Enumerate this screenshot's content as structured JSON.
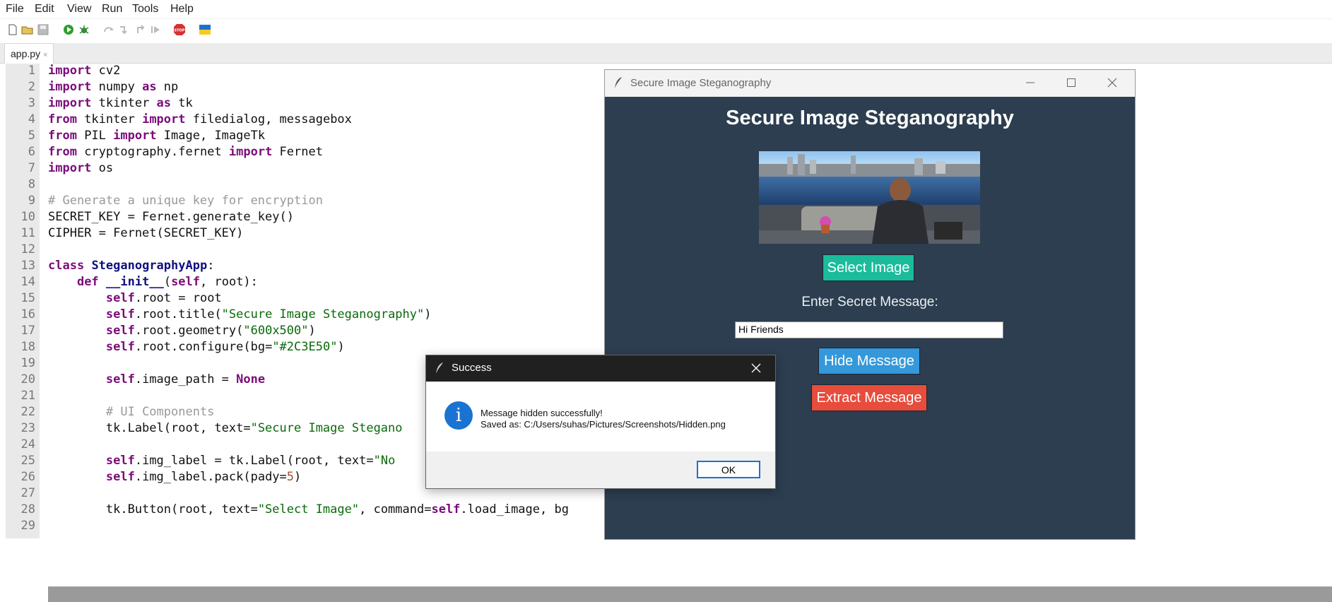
{
  "menubar": {
    "items": [
      "File",
      "Edit",
      "View",
      "Run",
      "Tools",
      "Help"
    ]
  },
  "toolbar": {
    "icons": [
      "new-file-icon",
      "open-file-icon",
      "save-icon",
      "run-icon",
      "debug-icon",
      "step-over-icon",
      "step-into-icon",
      "step-out-icon",
      "resume-icon",
      "stop-icon",
      "ukraine-flag-icon"
    ],
    "stop_label": "STOP",
    "colors": {
      "run": "#2e9e2e",
      "stop": "#d63030"
    }
  },
  "tabs": [
    {
      "label": "app.py",
      "close": "×"
    }
  ],
  "editor": {
    "line_numbers": [
      "1",
      "2",
      "3",
      "4",
      "5",
      "6",
      "7",
      "8",
      "9",
      "10",
      "11",
      "12",
      "13",
      "14",
      "15",
      "16",
      "17",
      "18",
      "19",
      "20",
      "21",
      "22",
      "23",
      "24",
      "25",
      "26",
      "27",
      "28",
      "29"
    ],
    "lines": [
      [
        {
          "t": "import",
          "c": "kw"
        },
        {
          "t": " cv2"
        }
      ],
      [
        {
          "t": "import",
          "c": "kw"
        },
        {
          "t": " numpy "
        },
        {
          "t": "as",
          "c": "kw"
        },
        {
          "t": " np"
        }
      ],
      [
        {
          "t": "import",
          "c": "kw"
        },
        {
          "t": " tkinter "
        },
        {
          "t": "as",
          "c": "kw"
        },
        {
          "t": " tk"
        }
      ],
      [
        {
          "t": "from",
          "c": "kw"
        },
        {
          "t": " tkinter "
        },
        {
          "t": "import",
          "c": "kw"
        },
        {
          "t": " filedialog, messagebox"
        }
      ],
      [
        {
          "t": "from",
          "c": "kw"
        },
        {
          "t": " PIL "
        },
        {
          "t": "import",
          "c": "kw"
        },
        {
          "t": " Image, ImageTk"
        }
      ],
      [
        {
          "t": "from",
          "c": "kw"
        },
        {
          "t": " cryptography.fernet "
        },
        {
          "t": "import",
          "c": "kw"
        },
        {
          "t": " Fernet"
        }
      ],
      [
        {
          "t": "import",
          "c": "kw"
        },
        {
          "t": " os"
        }
      ],
      [],
      [
        {
          "t": "# Generate a unique key for encryption",
          "c": "cm"
        }
      ],
      [
        {
          "t": "SECRET_KEY = Fernet.generate_key()"
        }
      ],
      [
        {
          "t": "CIPHER = Fernet(SECRET_KEY)"
        }
      ],
      [],
      [
        {
          "t": "class",
          "c": "kw"
        },
        {
          "t": " "
        },
        {
          "t": "SteganographyApp",
          "c": "cls"
        },
        {
          "t": ":"
        }
      ],
      [
        {
          "t": "    "
        },
        {
          "t": "def",
          "c": "kw"
        },
        {
          "t": " "
        },
        {
          "t": "__init__",
          "c": "cls"
        },
        {
          "t": "("
        },
        {
          "t": "self",
          "c": "kw"
        },
        {
          "t": ", root):"
        }
      ],
      [
        {
          "t": "        "
        },
        {
          "t": "self",
          "c": "kw"
        },
        {
          "t": ".root = root"
        }
      ],
      [
        {
          "t": "        "
        },
        {
          "t": "self",
          "c": "kw"
        },
        {
          "t": ".root.title("
        },
        {
          "t": "\"Secure Image Steganography\"",
          "c": "str"
        },
        {
          "t": ")"
        }
      ],
      [
        {
          "t": "        "
        },
        {
          "t": "self",
          "c": "kw"
        },
        {
          "t": ".root.geometry("
        },
        {
          "t": "\"600x500\"",
          "c": "str"
        },
        {
          "t": ")"
        }
      ],
      [
        {
          "t": "        "
        },
        {
          "t": "self",
          "c": "kw"
        },
        {
          "t": ".root.configure(bg="
        },
        {
          "t": "\"#2C3E50\"",
          "c": "str"
        },
        {
          "t": ")"
        }
      ],
      [],
      [
        {
          "t": "        "
        },
        {
          "t": "self",
          "c": "kw"
        },
        {
          "t": ".image_path = "
        },
        {
          "t": "None",
          "c": "kw"
        }
      ],
      [],
      [
        {
          "t": "        "
        },
        {
          "t": "# UI Components",
          "c": "cm"
        }
      ],
      [
        {
          "t": "        tk.Label(root, text="
        },
        {
          "t": "\"Secure Image Stegano",
          "c": "str"
        }
      ],
      [],
      [
        {
          "t": "        "
        },
        {
          "t": "self",
          "c": "kw"
        },
        {
          "t": ".img_label = tk.Label(root, text="
        },
        {
          "t": "\"No ",
          "c": "str"
        }
      ],
      [
        {
          "t": "        "
        },
        {
          "t": "self",
          "c": "kw"
        },
        {
          "t": ".img_label.pack(pady="
        },
        {
          "t": "5",
          "c": "num"
        },
        {
          "t": ")"
        }
      ],
      [],
      [
        {
          "t": "        tk.Button(root, text="
        },
        {
          "t": "\"Select Image\"",
          "c": "str"
        },
        {
          "t": ", command="
        },
        {
          "t": "self",
          "c": "kw"
        },
        {
          "t": ".load_image, bg"
        }
      ],
      []
    ]
  },
  "app_window": {
    "title": "Secure Image Steganography",
    "heading": "Secure Image Steganography",
    "select_button": "Select Image",
    "prompt_label": "Enter Secret Message:",
    "message_value": "Hi Friends",
    "hide_button": "Hide Message",
    "extract_button": "Extract Message",
    "bg_color": "#2C3E50"
  },
  "dialog": {
    "title": "Success",
    "line1": "Message hidden successfully!",
    "line2": "Saved as: C:/Users/suhas/Pictures/Screenshots/Hidden.png",
    "ok_button": "OK",
    "icon": "i"
  }
}
